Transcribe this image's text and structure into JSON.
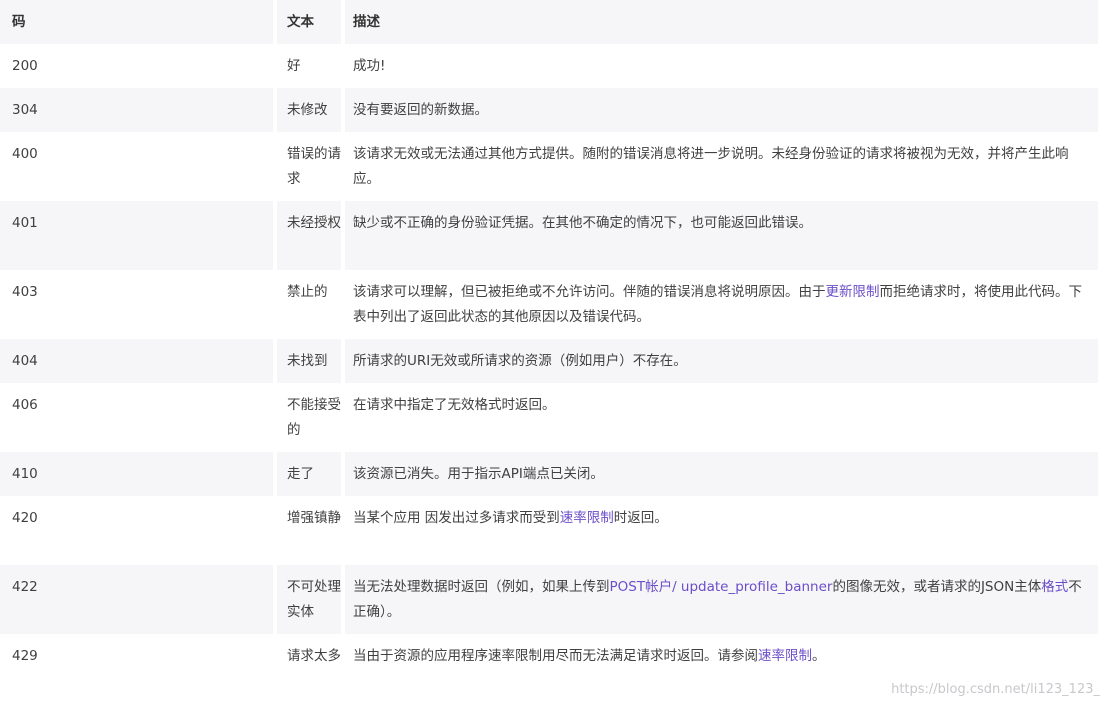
{
  "header": {
    "code": "码",
    "text": "文本",
    "desc": "描述"
  },
  "rows": [
    {
      "code": "200",
      "text": "好",
      "desc": [
        "成功!"
      ]
    },
    {
      "code": "304",
      "text": "未修改",
      "desc": [
        "没有要返回的新数据。"
      ]
    },
    {
      "code": "400",
      "text": "错误的请求",
      "desc": [
        "该请求无效或无法通过其他方式提供。随附的错误消息将进一步说明。未经身份验证的请求将被视为无效，并将产生此响应。"
      ]
    },
    {
      "code": "401",
      "text": "未经授权",
      "desc": [
        "缺少或不正确的身份验证凭据。在其他不确定的情况下，也可能返回此错误。"
      ]
    },
    {
      "code": "403",
      "text": "禁止的",
      "desc": [
        "该请求可以理解，但已被拒绝或不允许访问。伴随的错误消息将说明原因。由于",
        "更新限制",
        "而拒绝请求时，将使用此代码。下表中列出了返回此状态的其他原因以及错误代码。"
      ]
    },
    {
      "code": "404",
      "text": "未找到",
      "desc": [
        "所请求的URI无效或所请求的资源（例如用户）不存在。"
      ]
    },
    {
      "code": "406",
      "text": "不能接受的",
      "desc": [
        "在请求中指定了无效格式时返回。"
      ]
    },
    {
      "code": "410",
      "text": "走了",
      "desc": [
        "该资源已消失。用于指示API端点已关闭。"
      ]
    },
    {
      "code": "420",
      "text": "增强镇静",
      "desc": [
        "当某个应用 因发出过多请求而受到",
        "速率限制",
        "时返回。"
      ]
    },
    {
      "code": "422",
      "text": "不可处理实体",
      "desc": [
        "当无法处理数据时返回（例如，如果上传到",
        "POST帐户/ update_profile_banner",
        "的图像无效，或者请求的JSON主体",
        "格式",
        "不正确）。"
      ]
    },
    {
      "code": "429",
      "text": "请求太多",
      "desc": [
        "当由于资源的应用程序速率限制用尽而无法满足请求时返回。请参阅",
        "速率限制",
        "。"
      ]
    }
  ],
  "watermark": "https://blog.csdn.net/li123_123_"
}
